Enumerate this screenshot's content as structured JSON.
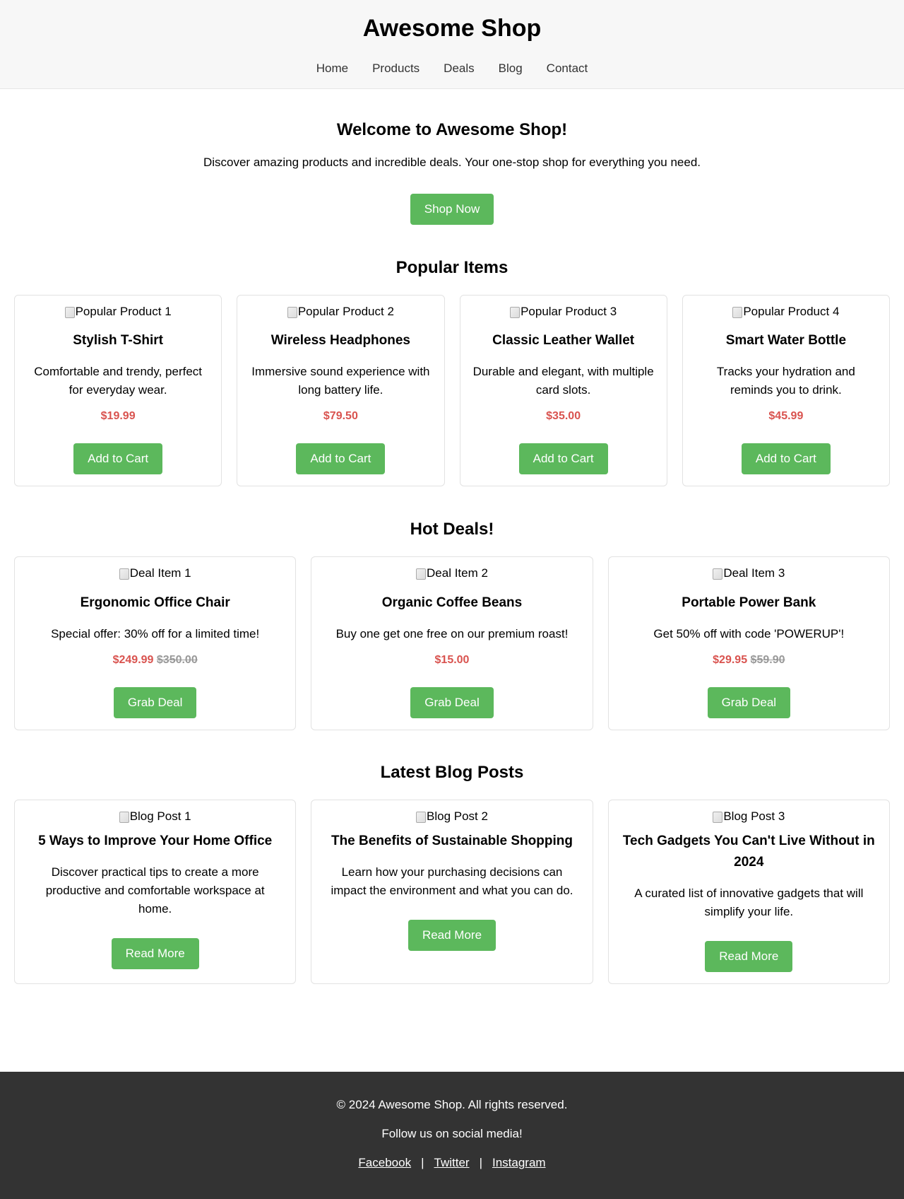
{
  "site": {
    "title": "Awesome Shop",
    "nav": [
      "Home",
      "Products",
      "Deals",
      "Blog",
      "Contact"
    ]
  },
  "hero": {
    "title": "Welcome to Awesome Shop!",
    "text": "Discover amazing products and incredible deals. Your one-stop shop for everything you need.",
    "cta": "Shop Now"
  },
  "popular": {
    "title": "Popular Items",
    "items": [
      {
        "image_alt": "Popular Product 1",
        "name": "Stylish T-Shirt",
        "description": "Comfortable and trendy, perfect for everyday wear.",
        "price": "$19.99",
        "button": "Add to Cart"
      },
      {
        "image_alt": "Popular Product 2",
        "name": "Wireless Headphones",
        "description": "Immersive sound experience with long battery life.",
        "price": "$79.50",
        "button": "Add to Cart"
      },
      {
        "image_alt": "Popular Product 3",
        "name": "Classic Leather Wallet",
        "description": "Durable and elegant, with multiple card slots.",
        "price": "$35.00",
        "button": "Add to Cart"
      },
      {
        "image_alt": "Popular Product 4",
        "name": "Smart Water Bottle",
        "description": "Tracks your hydration and reminds you to drink.",
        "price": "$45.99",
        "button": "Add to Cart"
      }
    ]
  },
  "deals": {
    "title": "Hot Deals!",
    "items": [
      {
        "image_alt": "Deal Item 1",
        "name": "Ergonomic Office Chair",
        "description": "Special offer: 30% off for a limited time!",
        "price": "$249.99",
        "old_price": "$350.00",
        "button": "Grab Deal"
      },
      {
        "image_alt": "Deal Item 2",
        "name": "Organic Coffee Beans",
        "description": "Buy one get one free on our premium roast!",
        "price": "$15.00",
        "old_price": "",
        "button": "Grab Deal"
      },
      {
        "image_alt": "Deal Item 3",
        "name": "Portable Power Bank",
        "description": "Get 50% off with code 'POWERUP'!",
        "price": "$29.95",
        "old_price": "$59.90",
        "button": "Grab Deal"
      }
    ]
  },
  "blog": {
    "title": "Latest Blog Posts",
    "posts": [
      {
        "image_alt": "Blog Post 1",
        "title": "5 Ways to Improve Your Home Office",
        "excerpt": "Discover practical tips to create a more productive and comfortable workspace at home.",
        "button": "Read More"
      },
      {
        "image_alt": "Blog Post 2",
        "title": "The Benefits of Sustainable Shopping",
        "excerpt": "Learn how your purchasing decisions can impact the environment and what you can do.",
        "button": "Read More"
      },
      {
        "image_alt": "Blog Post 3",
        "title": "Tech Gadgets You Can't Live Without in 2024",
        "excerpt": "A curated list of innovative gadgets that will simplify your life.",
        "button": "Read More"
      }
    ]
  },
  "footer": {
    "copyright": "© 2024 Awesome Shop. All rights reserved.",
    "follow": "Follow us on social media!",
    "social": [
      "Facebook",
      "Twitter",
      "Instagram"
    ],
    "separator": "|"
  },
  "colors": {
    "accent_green": "#5cb85c",
    "price_red": "#d9534f",
    "old_price_gray": "#999999",
    "header_bg": "#f7f7f7",
    "footer_bg": "#333333"
  },
  "icons": {
    "image_placeholder": "broken-image-icon"
  }
}
